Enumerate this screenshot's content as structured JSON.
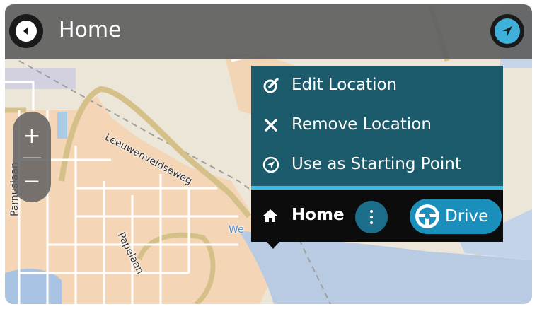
{
  "header": {
    "title": "Home",
    "back_icon": "back-arrow-icon",
    "locate_icon": "current-location-icon"
  },
  "map": {
    "zoom_in_label": "+",
    "zoom_out_label": "−",
    "streets": [
      "Leeuwenveldseweg",
      "Papelaan",
      "Parnuslaan",
      "We"
    ]
  },
  "menu": {
    "items": [
      {
        "label": "Edit Location",
        "icon": "edit-icon"
      },
      {
        "label": "Remove Location",
        "icon": "remove-icon"
      },
      {
        "label": "Use as Starting Point",
        "icon": "starting-point-icon"
      }
    ]
  },
  "bottom_bar": {
    "title": "Home",
    "icon": "home-icon",
    "more_icon": "more-options-icon",
    "drive_label": "Drive",
    "drive_icon": "steering-wheel-icon"
  },
  "colors": {
    "header": "#606060",
    "menu": "#1c5b6b",
    "accent": "#3dbde6",
    "drive_button": "#1a8fbb",
    "bar": "#0c0c0c"
  }
}
